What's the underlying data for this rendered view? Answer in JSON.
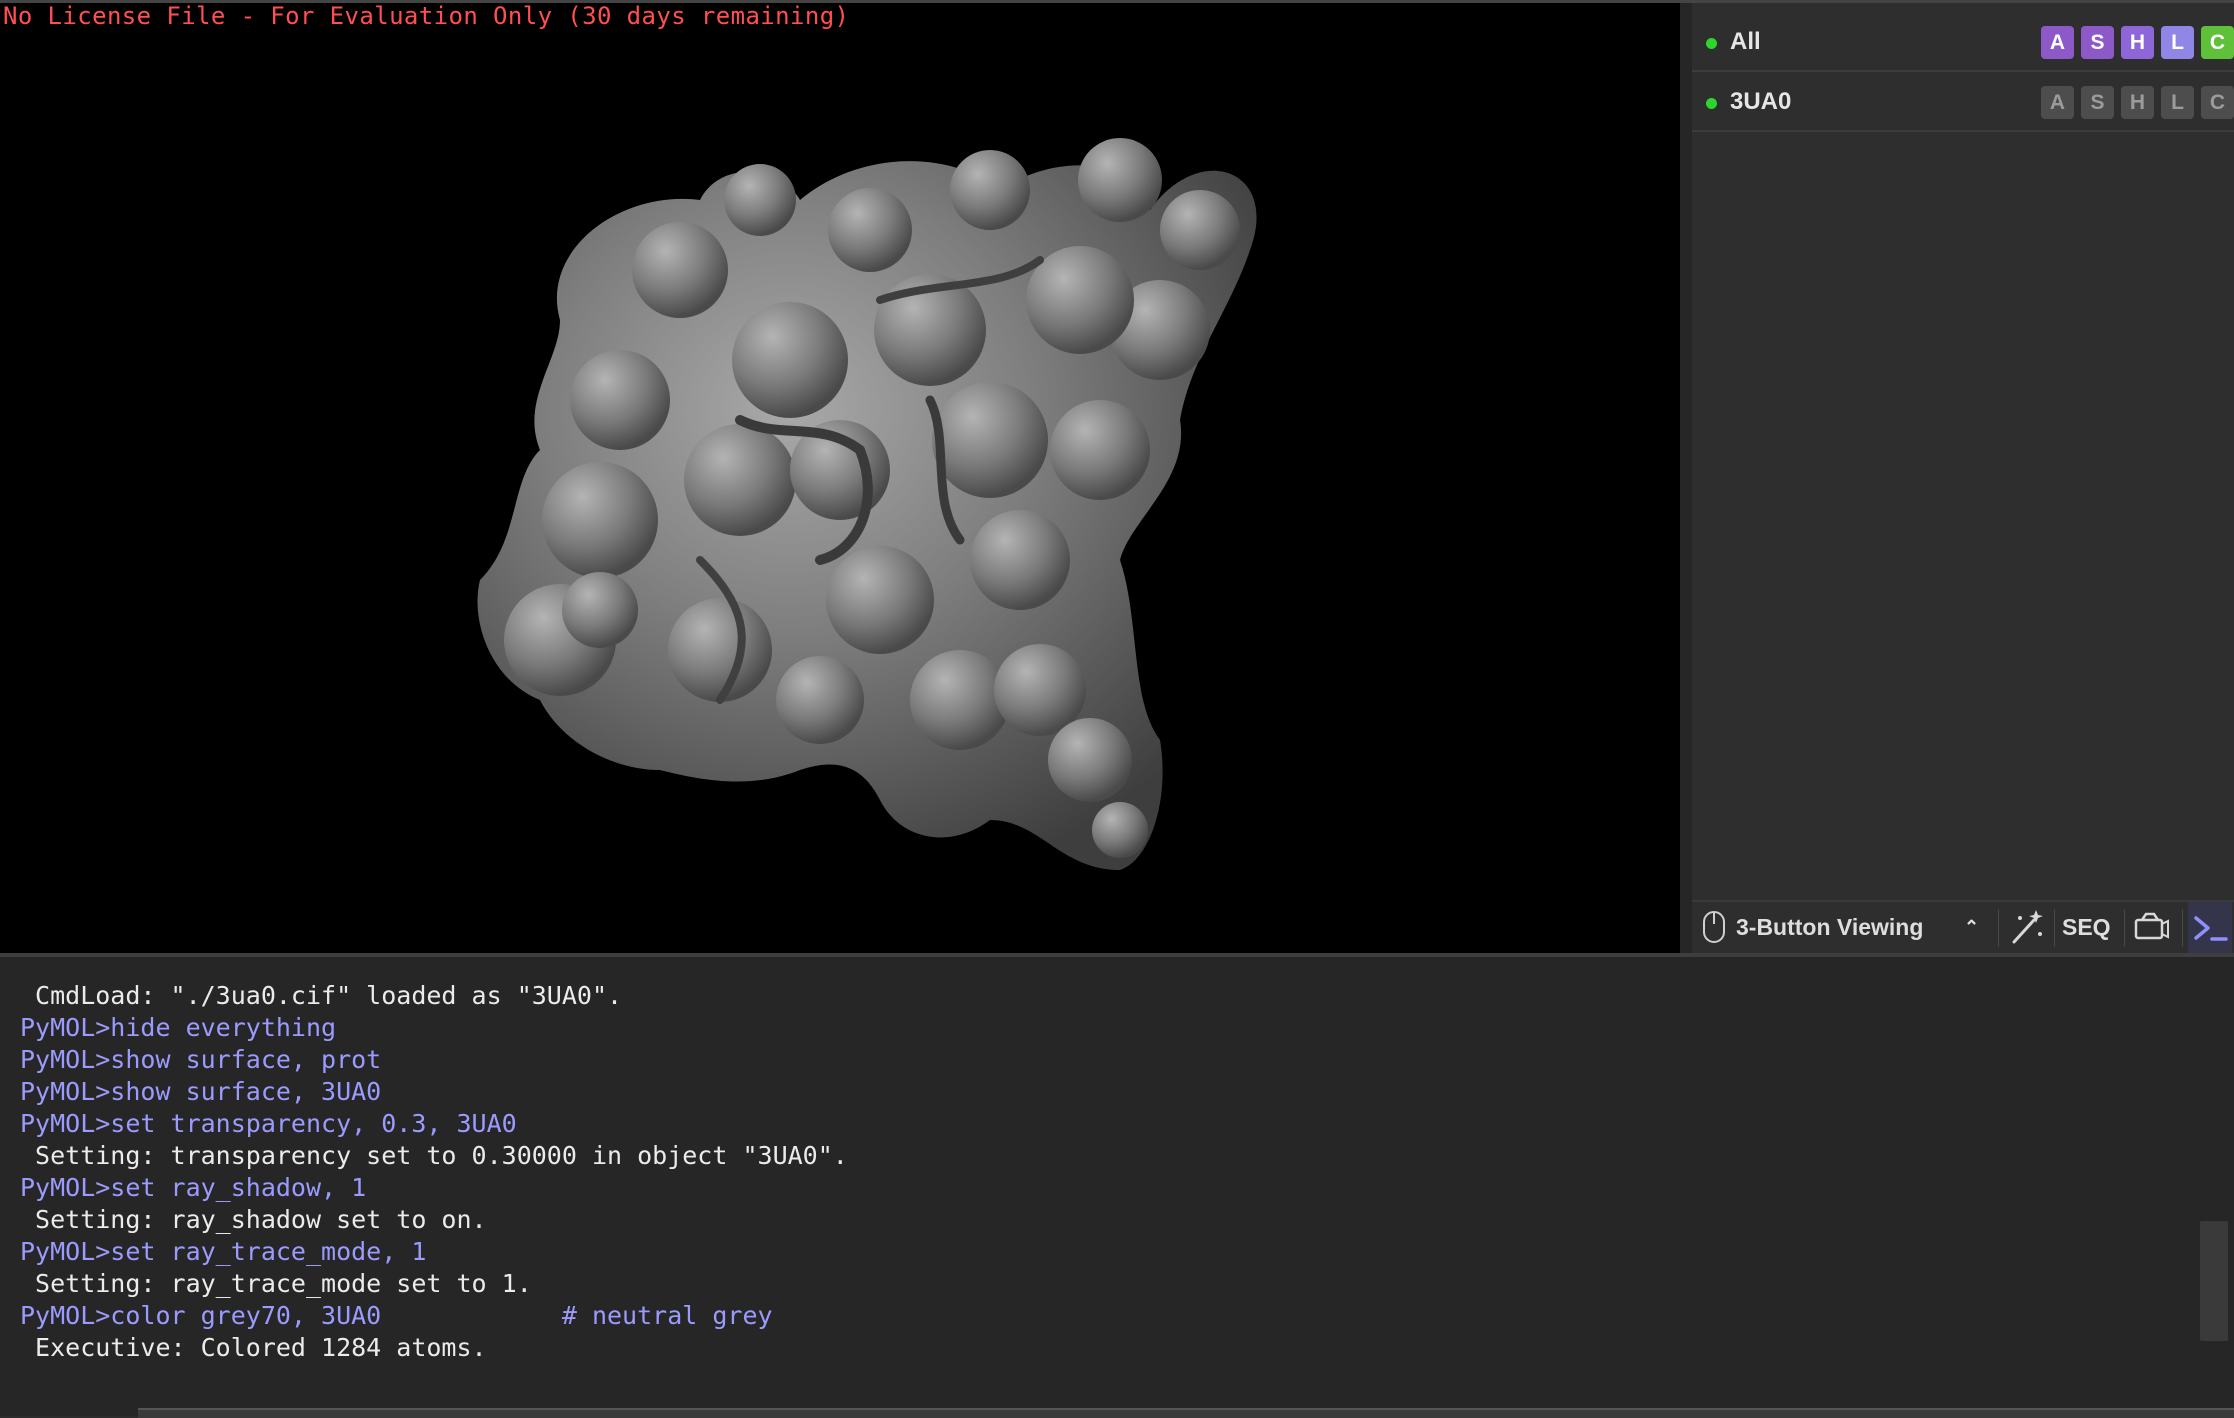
{
  "license_notice": "No License File - For Evaluation Only (30 days remaining)",
  "objects": [
    {
      "name": "All",
      "enabled": true,
      "buttons": [
        "A",
        "S",
        "H",
        "L",
        "C"
      ],
      "style": "active"
    },
    {
      "name": "3UA0",
      "enabled": true,
      "buttons": [
        "A",
        "S",
        "H",
        "L",
        "C"
      ],
      "style": "muted"
    }
  ],
  "toolbar": {
    "mouse_mode": "3-Button Viewing",
    "seq_label": "SEQ",
    "icons": [
      "mouse-icon",
      "chevron-up-icon",
      "magic-wand-icon",
      "camera-icon",
      "terminal-icon"
    ]
  },
  "console": {
    "lines": [
      {
        "type": "out",
        "text": " CmdLoad: \"./3ua0.cif\" loaded as \"3UA0\"."
      },
      {
        "type": "cmd",
        "text": "PyMOL>hide everything"
      },
      {
        "type": "cmd",
        "text": "PyMOL>show surface, prot"
      },
      {
        "type": "cmd",
        "text": "PyMOL>show surface, 3UA0"
      },
      {
        "type": "cmd",
        "text": "PyMOL>set transparency, 0.3, 3UA0"
      },
      {
        "type": "out",
        "text": " Setting: transparency set to 0.30000 in object \"3UA0\"."
      },
      {
        "type": "cmd",
        "text": "PyMOL>set ray_shadow, 1"
      },
      {
        "type": "out",
        "text": " Setting: ray_shadow set to on."
      },
      {
        "type": "cmd",
        "text": "PyMOL>set ray_trace_mode, 1"
      },
      {
        "type": "out",
        "text": " Setting: ray_trace_mode set to 1."
      },
      {
        "type": "cmd",
        "text": "PyMOL>color grey70, 3UA0            # neutral grey"
      },
      {
        "type": "out",
        "text": " Executive: Colored 1284 atoms."
      }
    ]
  },
  "colors": {
    "license_text": "#ff4f4f",
    "command_text": "#9b9bff",
    "output_text": "#ebebeb",
    "enabled_dot": "#2cd62c",
    "surface": "#7a7a7a"
  }
}
